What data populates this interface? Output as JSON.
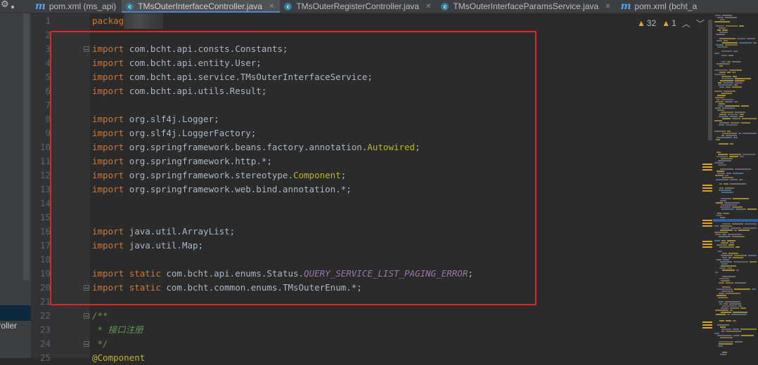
{
  "tabs": [
    {
      "name": "pom.xml (ms_api)",
      "icon": "maven-m-icon",
      "closable": false,
      "active": false
    },
    {
      "name": "TMsOuterInterfaceController.java",
      "icon": "java-class-icon",
      "closable": true,
      "active": true
    },
    {
      "name": "TMsOuterRegisterController.java",
      "icon": "java-class-icon",
      "closable": true,
      "active": false
    },
    {
      "name": "TMsOuterInterfaceParamsService.java",
      "icon": "java-class-icon",
      "closable": true,
      "active": false
    },
    {
      "name": "pom.xml (bcht_a",
      "icon": "maven-m-icon",
      "closable": false,
      "active": false
    }
  ],
  "tab_icon_letters": {
    "maven": "m",
    "java_class": "c"
  },
  "left_panel": {
    "label": "troller"
  },
  "inspection": {
    "warnings": "32",
    "weak_warnings": "1"
  },
  "line_numbers": [
    "1",
    "2",
    "3",
    "4",
    "5",
    "6",
    "7",
    "8",
    "9",
    "10",
    "11",
    "12",
    "13",
    "14",
    "15",
    "16",
    "17",
    "18",
    "19",
    "20",
    "21",
    "22",
    "23",
    "24",
    "25"
  ],
  "code": {
    "l1": "packag",
    "imp3": "com.bcht.api.consts.Constants;",
    "imp4": "com.bcht.api.entity.User;",
    "imp5": "com.bcht.api.service.TMsOuterInterfaceService;",
    "imp6": "com.bcht.api.utils.Result;",
    "imp8": "org.slf4j.Logger;",
    "imp9": "org.slf4j.LoggerFactory;",
    "imp10a": "org.springframework.beans.factory.annotation.",
    "imp10b": "Autowired",
    "imp11": "org.springframework.http.*;",
    "imp12a": "org.springframework.stereotype.",
    "imp12b": "Component",
    "imp13": "org.springframework.web.bind.annotation.*;",
    "imp16": "java.util.ArrayList;",
    "imp17": "java.util.Map;",
    "imp19a": "com.bcht.api.enums.Status.",
    "imp19b": "QUERY_SERVICE_LIST_PAGING_ERROR",
    "imp20": "com.bcht.common.enums.TMsOuterEnum.*;",
    "c22": "/**",
    "c23": " * 接口注册",
    "c24": " */",
    "l25": "@Component"
  },
  "tokens": {
    "import": "import",
    "static": "static",
    "semicolon": ";"
  },
  "colors": {
    "background": "#2b2b2b",
    "keyword": "#cc7832",
    "annotation": "#bbb529",
    "static_field": "#9876aa",
    "comment": "#629755",
    "default_text": "#a9b7c6",
    "highlight_box": "#e0262a"
  }
}
